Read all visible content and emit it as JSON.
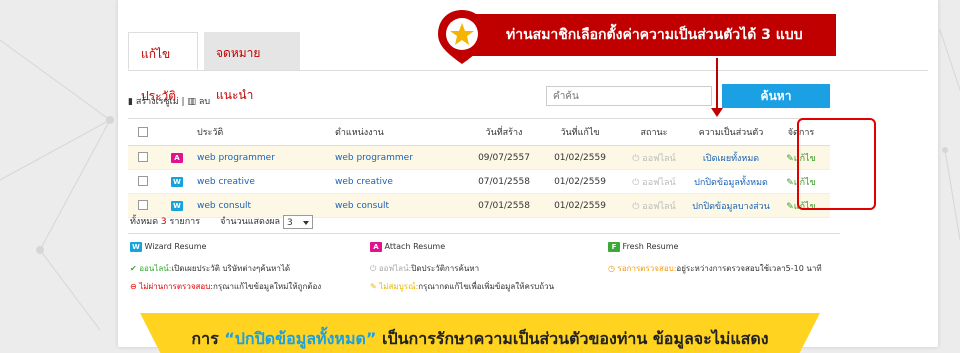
{
  "tabs": [
    {
      "label": "แก้ไขประวัติ"
    },
    {
      "label": "จดหมายแนะนำ"
    }
  ],
  "toolbar": {
    "create_label": "สร้างเรซูเม่",
    "separator": "|",
    "delete_label": "ลบ"
  },
  "search": {
    "placeholder": "คำค้น",
    "button_label": "ค้นหา"
  },
  "table": {
    "headers": [
      "ประวัติ",
      "ตำแหน่งงาน",
      "วันที่สร้าง",
      "วันที่แก้ไข",
      "สถานะ",
      "ความเป็นส่วนตัว",
      "จัดการ"
    ],
    "rows": [
      {
        "badge": "A",
        "name": "web programmer",
        "position": "web programmer",
        "created": "09/07/2557",
        "modified": "01/02/2559",
        "status": "ออฟไลน์",
        "privacy": "เปิดเผยทั้งหมด",
        "action": "แก้ไข"
      },
      {
        "badge": "W",
        "name": "web creative",
        "position": "web creative",
        "created": "07/01/2558",
        "modified": "01/02/2559",
        "status": "ออฟไลน์",
        "privacy": "ปกปิดข้อมูลทั้งหมด",
        "action": "แก้ไข"
      },
      {
        "badge": "W",
        "name": "web consult",
        "position": "web consult",
        "created": "07/01/2558",
        "modified": "01/02/2559",
        "status": "ออฟไลน์",
        "privacy": "ปกปิดข้อมูลบางส่วน",
        "action": "แก้ไข"
      }
    ]
  },
  "summary": {
    "total_prefix": "ทั้งหมด",
    "total_count": "3",
    "total_suffix": "รายการ",
    "per_page_label": "จำนวนแสดงผล",
    "per_page_value": "3"
  },
  "legend": {
    "wizard": {
      "badge": "W",
      "label": "Wizard Resume"
    },
    "attach": {
      "badge": "A",
      "label": "Attach Resume"
    },
    "fresh": {
      "badge": "F",
      "label": "Fresh Resume"
    },
    "online": {
      "title": "ออนไลน์:",
      "text": "เปิดเผยประวัติ บริษัทต่างๆค้นหาได้"
    },
    "offline": {
      "title": "ออฟไลน์:",
      "text": "ปิดประวัติการค้นหา"
    },
    "pending": {
      "title": "รอการตรวจสอบ:",
      "text": "อยู่ระหว่างการตรวจสอบใช้เวลา5-10 นาที"
    },
    "rejected": {
      "title": "ไม่ผ่านการตรวจสอบ:",
      "text": "กรุณาแก้ไขข้อมูลใหม่ให้ถูกต้อง"
    },
    "incomplete": {
      "title": "ไม่สมบูรณ์:",
      "text": "กรุณากดแก้ไขเพื่อเพิ่มข้อมูลให้ครบถ้วน"
    }
  },
  "callout": {
    "text": "ท่านสมาชิกเลือกตั้งค่าความเป็นส่วนตัวได้ 3 แบบ"
  },
  "banner": {
    "prefix": "การ",
    "highlight": "“ปกปิดข้อมูลทั้งหมด”",
    "suffix": "เป็นการรักษาความเป็นส่วนตัวของท่าน ข้อมูลจะไม่แสดง"
  },
  "colors": {
    "accent_red": "#c00000",
    "search_blue": "#1aa0e3",
    "link_blue": "#1a63b5",
    "banner_yellow": "#ffd31f",
    "attach_pink": "#e2118c",
    "wizard_blue": "#17a3db",
    "fresh_green": "#3aa935"
  },
  "icons": [
    "document-icon",
    "trash-icon",
    "power-icon",
    "pencil-icon",
    "check-circle-icon",
    "minus-circle-icon",
    "clock-icon",
    "edit-square-icon",
    "star-marker-icon",
    "chevron-down-icon"
  ]
}
